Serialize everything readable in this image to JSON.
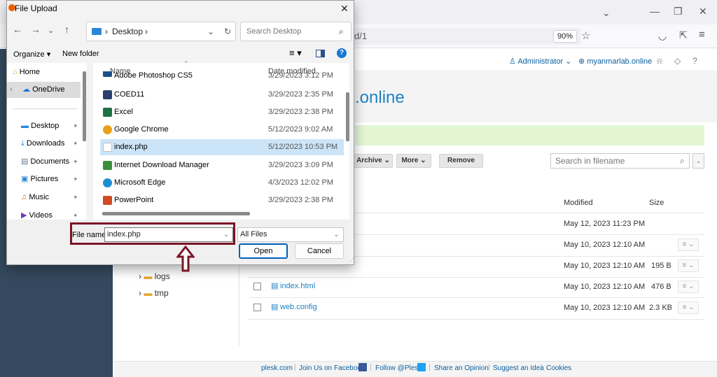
{
  "dialog": {
    "title": "File Upload",
    "breadcrumb": [
      "Desktop"
    ],
    "search_placeholder": "Search Desktop",
    "commands": {
      "organize": "Organize",
      "new_folder": "New folder"
    },
    "nav_items": [
      {
        "label": "Home",
        "icon": "home-icon"
      },
      {
        "label": "OneDrive",
        "icon": "cloud-icon"
      },
      {
        "label": "Desktop",
        "icon": "desktop-folder-icon"
      },
      {
        "label": "Downloads",
        "icon": "download-icon"
      },
      {
        "label": "Documents",
        "icon": "documents-icon"
      },
      {
        "label": "Pictures",
        "icon": "pictures-icon"
      },
      {
        "label": "Music",
        "icon": "music-icon"
      },
      {
        "label": "Videos",
        "icon": "videos-icon"
      }
    ],
    "columns": {
      "name": "Name",
      "date": "Date modified"
    },
    "files": [
      {
        "name": "Adobe Photoshop CS5",
        "date": "3/29/2023 3:12 PM",
        "color": "#1f4f8b",
        "selected": false
      },
      {
        "name": "COED11",
        "date": "3/29/2023 2:35 PM",
        "color": "#2a3f6e",
        "selected": false
      },
      {
        "name": "Excel",
        "date": "3/29/2023 2:38 PM",
        "color": "#1e7145",
        "selected": false
      },
      {
        "name": "Google Chrome",
        "date": "5/12/2023 9:02 AM",
        "color": "#e8a019",
        "selected": false
      },
      {
        "name": "index.php",
        "date": "5/12/2023 10:53 PM",
        "color": "#b9c3cf",
        "selected": true
      },
      {
        "name": "Internet Download Manager",
        "date": "3/29/2023 3:09 PM",
        "color": "#3b8f3b",
        "selected": false
      },
      {
        "name": "Microsoft Edge",
        "date": "4/3/2023 12:02 PM",
        "color": "#1b8fd1",
        "selected": false
      },
      {
        "name": "PowerPoint",
        "date": "3/29/2023 2:38 PM",
        "color": "#d04a24",
        "selected": false
      }
    ],
    "file_name_label": "File name:",
    "file_name_value": "index.php",
    "file_type": "All Files",
    "open_label": "Open",
    "cancel_label": "Cancel",
    "highlight_color": "#7b1526"
  },
  "browser": {
    "url_fragment": "d/1",
    "zoom": "90%"
  },
  "plesk": {
    "user": "Administrator",
    "subscription": "myanmarlab.online",
    "domain_title": "myanmarlab.online",
    "domain_title_visible": ".online",
    "toolbar": {
      "archive": "Archive",
      "more": "More",
      "remove": "Remove"
    },
    "search_placeholder": "Search in filename",
    "columns": {
      "modified": "Modified",
      "size": "Size"
    },
    "rows": [
      {
        "name": "",
        "modified": "May 12, 2023 11:23 PM",
        "size": ""
      },
      {
        "name": "",
        "modified": "May 10, 2023 12:10 AM",
        "size": ""
      },
      {
        "name": "",
        "modified": "May 10, 2023 12:10 AM",
        "size": "195 B"
      },
      {
        "name": "index.html",
        "modified": "May 10, 2023 12:10 AM",
        "size": "476 B"
      },
      {
        "name": "web.config",
        "modified": "May 10, 2023 12:10 AM",
        "size": "2.3 KB"
      }
    ],
    "tree": [
      {
        "label": "logs"
      },
      {
        "label": "tmp"
      }
    ],
    "footer": [
      "plesk.com",
      "Join Us on Facebook",
      "Follow @Plesk",
      "Share an Opinion",
      "Suggest an Idea",
      "Cookies"
    ],
    "accent": "#1e82c3",
    "sidebar_color": "#34495e"
  }
}
